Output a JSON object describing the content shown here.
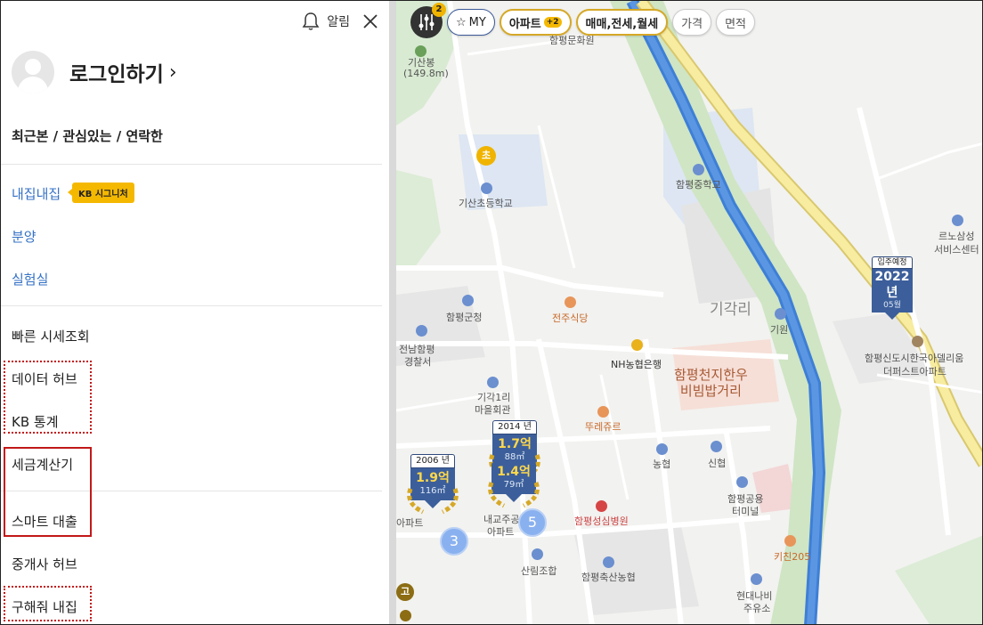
{
  "sidebar": {
    "notice_label": "알림",
    "login_label": "로그인하기",
    "login_chevron": "›",
    "recent_label": "최근본 / 관심있는 / 연락한",
    "items": [
      {
        "label": "내집내집"
      },
      {
        "label": "분양"
      },
      {
        "label": "실험실"
      },
      {
        "label": "빠른 시세조회"
      },
      {
        "label": "데이터 허브"
      },
      {
        "label": "KB 통계"
      },
      {
        "label": "세금계산기"
      },
      {
        "label": "스마트 대출"
      },
      {
        "label": "중개사 허브"
      },
      {
        "label": "구해줘 내집"
      }
    ],
    "kb_badge": "KB 시그니처"
  },
  "filters": {
    "filter_count": "2",
    "my": "MY",
    "apartment": "아파트",
    "apartment_plus": "+2",
    "trade": "매매,전세,월세",
    "price": "가격",
    "area": "면적"
  },
  "map": {
    "labels": {
      "peak": "기산봉",
      "peak_height": "(149.8m)",
      "culture_hall": "함평문화원",
      "elem_school": "기산초등학교",
      "mid_school": "함평중학교",
      "service_center_1": "르노삼성",
      "service_center_2": "서비스센터",
      "county_office": "함평군청",
      "restaurant": "전주식당",
      "district": "기각리",
      "giwon": "기원",
      "police_1": "전남함평",
      "police_2": "경찰서",
      "bank": "NH농협은행",
      "area_1": "함평천지한우",
      "area_2": "비빔밥거리",
      "complex_1": "함평신도시한국아델리움",
      "complex_2": "더퍼스트아파트",
      "village_hall_1": "기각1리",
      "village_hall_2": "마을회관",
      "bakery": "뚜레쥬르",
      "nonghyup": "농협",
      "shinhyup": "신협",
      "bus_1": "함평공용",
      "bus_2": "터미널",
      "hospital": "함평성심병원",
      "apt_a_1": "내교주공",
      "apt_a_2": "아파트",
      "apt_b": "아파트",
      "sanrim": "산림조합",
      "livestock": "함평축산농협",
      "kitchen": "키친205",
      "gas_1": "현대나비",
      "gas_2": "주유소"
    },
    "school_badge": "초",
    "high_badge": "고",
    "clusters": [
      "5",
      "3"
    ],
    "markers": [
      {
        "year": "2014 년",
        "price": "1.7억",
        "size": "88㎡",
        "rank": "1"
      },
      {
        "year": "",
        "price": "1.4억",
        "size": "79㎡",
        "rank": "1"
      },
      {
        "year": "2006 년",
        "price": "1.9억",
        "size": "116㎡",
        "rank": "3"
      }
    ],
    "scheduled": {
      "label": "입주예정",
      "year": "2022년",
      "month": "05월"
    }
  },
  "colors": {
    "accent_blue": "#3572c6",
    "kb_yellow": "#f5b800",
    "highlight_red": "#c21818",
    "marker_navy": "#3c5f9b",
    "river": "#3e7fd6",
    "highway": "#f5e89a"
  }
}
